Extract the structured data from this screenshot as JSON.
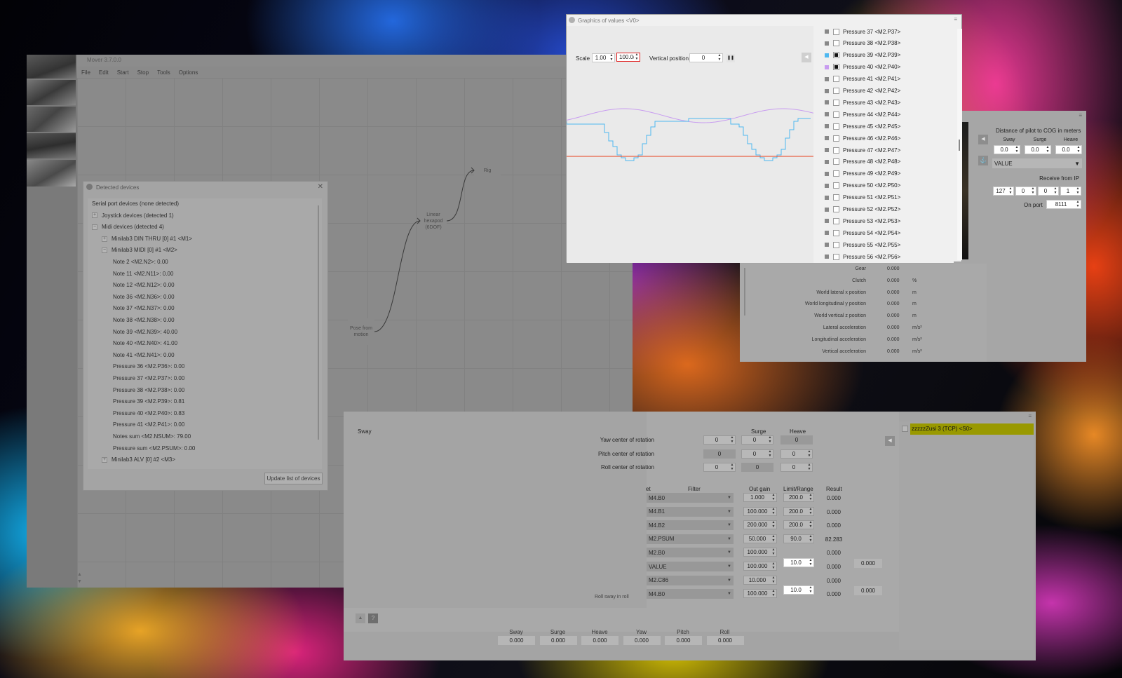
{
  "main_window": {
    "title": "Mover 3.7.0.0",
    "menu": [
      "File",
      "Edit",
      "Start",
      "Stop",
      "Tools",
      "Options"
    ],
    "nodes": {
      "pose": "Pose from motion",
      "hexapod": "Linear hexapod (6DOF)",
      "rig": "Rig"
    },
    "side_scroll_up": "▲",
    "side_scroll_down": "▼"
  },
  "devices": {
    "title": "Detected devices",
    "close": "✕",
    "rows": [
      {
        "text": "Serial port devices (none detected)",
        "indent": 0,
        "exp": ""
      },
      {
        "text": "Joystick devices (detected 1)",
        "indent": 0,
        "exp": "+"
      },
      {
        "text": "Midi devices (detected 4)",
        "indent": 0,
        "exp": "−"
      },
      {
        "text": "Minilab3 DIN THRU [0] #1 <M1>",
        "indent": 1,
        "exp": "+"
      },
      {
        "text": "Minilab3 MIDI [0] #1 <M2>",
        "indent": 1,
        "exp": "−"
      },
      {
        "text": "Note 2 <M2.N2>: 0.00",
        "indent": 2,
        "exp": ""
      },
      {
        "text": "Note 11 <M2.N11>: 0.00",
        "indent": 2,
        "exp": ""
      },
      {
        "text": "Note 12 <M2.N12>: 0.00",
        "indent": 2,
        "exp": ""
      },
      {
        "text": "Note 36 <M2.N36>: 0.00",
        "indent": 2,
        "exp": ""
      },
      {
        "text": "Note 37 <M2.N37>: 0.00",
        "indent": 2,
        "exp": ""
      },
      {
        "text": "Note 38 <M2.N38>: 0.00",
        "indent": 2,
        "exp": ""
      },
      {
        "text": "Note 39 <M2.N39>: 40.00",
        "indent": 2,
        "exp": ""
      },
      {
        "text": "Note 40 <M2.N40>: 41.00",
        "indent": 2,
        "exp": ""
      },
      {
        "text": "Note 41 <M2.N41>: 0.00",
        "indent": 2,
        "exp": ""
      },
      {
        "text": "Pressure 36 <M2.P36>: 0.00",
        "indent": 2,
        "exp": ""
      },
      {
        "text": "Pressure 37 <M2.P37>: 0.00",
        "indent": 2,
        "exp": ""
      },
      {
        "text": "Pressure 38 <M2.P38>: 0.00",
        "indent": 2,
        "exp": ""
      },
      {
        "text": "Pressure 39 <M2.P39>: 0.81",
        "indent": 2,
        "exp": ""
      },
      {
        "text": "Pressure 40 <M2.P40>: 0.83",
        "indent": 2,
        "exp": ""
      },
      {
        "text": "Pressure 41 <M2.P41>: 0.00",
        "indent": 2,
        "exp": ""
      },
      {
        "text": "Notes sum <M2.NSUM>: 79.00",
        "indent": 2,
        "exp": ""
      },
      {
        "text": "Pressure sum <M2.PSUM>: 0.00",
        "indent": 2,
        "exp": ""
      },
      {
        "text": "Minilab3 ALV [0] #2 <M3>",
        "indent": 1,
        "exp": "+"
      }
    ],
    "update_button": "Update list of devices"
  },
  "graphics": {
    "title": "Graphics of values <V0>",
    "scale_label": "Scale",
    "scale_value": "1.00",
    "scale_max": "100.0(",
    "vpos_label": "Vertical position",
    "vpos_value": "0",
    "pause_icon": "❚❚",
    "collapse_arrow": "◀",
    "colors": {
      "pressure39": "#4fb8f0",
      "pressure40": "#c89cf0",
      "baseline": "#e8401c"
    },
    "legend": [
      {
        "label": "Pressure 37 <M2.P37>",
        "checked": false,
        "color": "#888888"
      },
      {
        "label": "Pressure 38 <M2.P38>",
        "checked": false,
        "color": "#888888"
      },
      {
        "label": "Pressure 39 <M2.P39>",
        "checked": true,
        "color": "#4fb8f0"
      },
      {
        "label": "Pressure 40 <M2.P40>",
        "checked": true,
        "color": "#c89cf0"
      },
      {
        "label": "Pressure 41 <M2.P41>",
        "checked": false,
        "color": "#888888"
      },
      {
        "label": "Pressure 42 <M2.P42>",
        "checked": false,
        "color": "#888888"
      },
      {
        "label": "Pressure 43 <M2.P43>",
        "checked": false,
        "color": "#888888"
      },
      {
        "label": "Pressure 44 <M2.P44>",
        "checked": false,
        "color": "#888888"
      },
      {
        "label": "Pressure 45 <M2.P45>",
        "checked": false,
        "color": "#888888"
      },
      {
        "label": "Pressure 46 <M2.P46>",
        "checked": false,
        "color": "#888888"
      },
      {
        "label": "Pressure 47 <M2.P47>",
        "checked": false,
        "color": "#888888"
      },
      {
        "label": "Pressure 48 <M2.P48>",
        "checked": false,
        "color": "#888888"
      },
      {
        "label": "Pressure 49 <M2.P49>",
        "checked": false,
        "color": "#888888"
      },
      {
        "label": "Pressure 50 <M2.P50>",
        "checked": false,
        "color": "#888888"
      },
      {
        "label": "Pressure 51 <M2.P51>",
        "checked": false,
        "color": "#888888"
      },
      {
        "label": "Pressure 52 <M2.P52>",
        "checked": false,
        "color": "#888888"
      },
      {
        "label": "Pressure 53 <M2.P53>",
        "checked": false,
        "color": "#888888"
      },
      {
        "label": "Pressure 54 <M2.P54>",
        "checked": false,
        "color": "#888888"
      },
      {
        "label": "Pressure 55 <M2.P55>",
        "checked": false,
        "color": "#888888"
      },
      {
        "label": "Pressure 56 <M2.P56>",
        "checked": false,
        "color": "#888888"
      }
    ]
  },
  "telemetry": {
    "cog_title": "Distance of pilot to COG in meters",
    "axes": [
      "Sway",
      "Surge",
      "Heave"
    ],
    "cog_values": [
      "0.0",
      "0.0",
      "0.0"
    ],
    "source_combo": "VALUE",
    "receive_label": "Receive from IP",
    "ip": [
      "127",
      "0",
      "0",
      "1"
    ],
    "port_label": "On port",
    "port_value": "8111",
    "rows": [
      {
        "label": "Gear",
        "value": "0.000",
        "unit": ""
      },
      {
        "label": "Clutch",
        "value": "0.000",
        "unit": "%"
      },
      {
        "label": "World lateral x position",
        "value": "0.000",
        "unit": "m"
      },
      {
        "label": "World longitudinal y position",
        "value": "0.000",
        "unit": "m"
      },
      {
        "label": "World vertical z position",
        "value": "0.000",
        "unit": "m"
      },
      {
        "label": "Lateral acceleration",
        "value": "0.000",
        "unit": "m/s²"
      },
      {
        "label": "Longitudinal acceleration",
        "value": "0.000",
        "unit": "m/s²"
      },
      {
        "label": "Vertical acceleration",
        "value": "0.000",
        "unit": "m/s²"
      }
    ]
  },
  "pose": {
    "headers": {
      "sway": "Sway",
      "surge": "Surge",
      "heave": "Heave"
    },
    "rotation_rows": [
      {
        "label": "Yaw center of rotation",
        "sway": "0",
        "surge": "0",
        "heave": "0"
      },
      {
        "label": "Pitch center of rotation",
        "sway": "0",
        "surge": "0",
        "heave": "0"
      },
      {
        "label": "Roll center of rotation",
        "sway": "0",
        "surge": "0",
        "heave": "0"
      }
    ],
    "col_headers": {
      "input": "et",
      "filter": "Filter",
      "gain": "Out gain",
      "limit": "Limit/Range",
      "result": "Result"
    },
    "rows": [
      {
        "source": "M4.B0",
        "gain": "1.000",
        "limit": "200.0",
        "result": "0.000"
      },
      {
        "source": "M4.B1",
        "gain": "100.000",
        "limit": "200.0",
        "result": "0.000"
      },
      {
        "source": "M4.B2",
        "gain": "200.000",
        "limit": "200.0",
        "result": "0.000"
      },
      {
        "source": "M2.PSUM",
        "gain": "50.000",
        "limit": "90.0",
        "result": "82.283"
      },
      {
        "source": "M2.B0",
        "gain": "100.000",
        "limit": "",
        "result": "0.000"
      },
      {
        "source": "VALUE",
        "gain": "100.000",
        "limit": "",
        "result": "0.000"
      },
      {
        "source": "M2.C86",
        "gain": "10.000",
        "limit": "",
        "result": "0.000"
      },
      {
        "source": "M4.B0",
        "gain": "100.000",
        "limit": "",
        "result": "0.000"
      }
    ],
    "merged": [
      {
        "limit": "10.0",
        "result": "0.000"
      },
      {
        "limit": "10.0",
        "result": "0.000"
      }
    ],
    "row_partial_label": "Roll sway in roll",
    "collapse_arrow": "◀",
    "output_label": "zzzzzZusi 3 (TCP) <S0>",
    "output_color": "#ffff00",
    "help": "?",
    "up": "▲",
    "outputs": [
      {
        "label": "Sway",
        "value": "0.000"
      },
      {
        "label": "Surge",
        "value": "0.000"
      },
      {
        "label": "Heave",
        "value": "0.000"
      },
      {
        "label": "Yaw",
        "value": "0.000"
      },
      {
        "label": "Pitch",
        "value": "0.000"
      },
      {
        "label": "Roll",
        "value": "0.000"
      }
    ]
  }
}
